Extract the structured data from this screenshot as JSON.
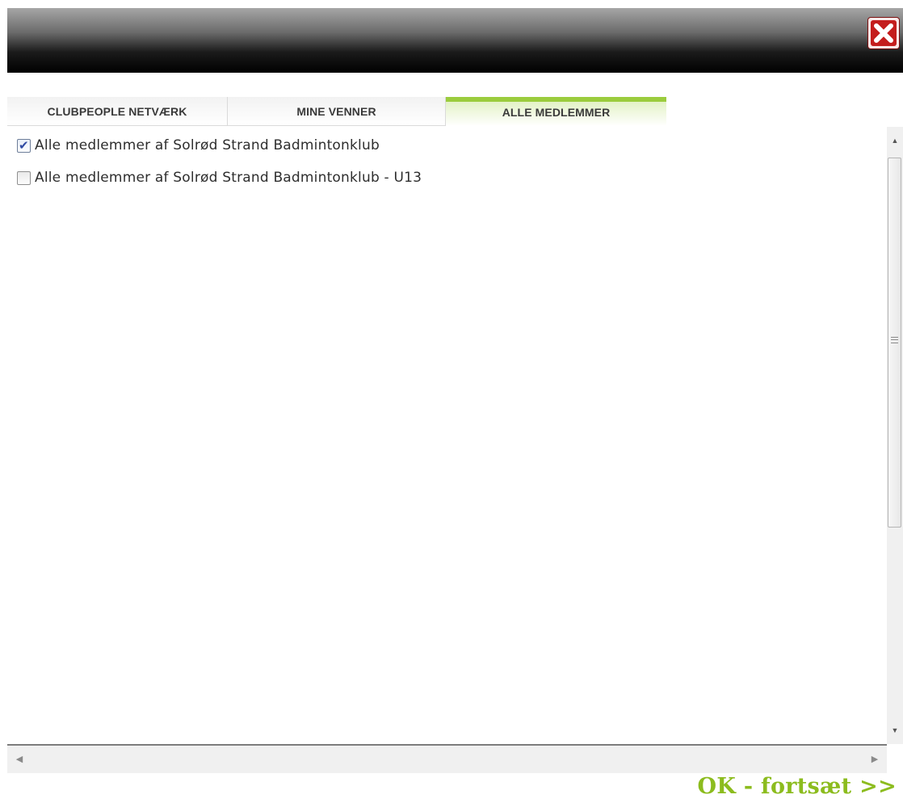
{
  "dialog": {
    "close_icon": "close-x-icon",
    "accent_color": "#9bcc3d"
  },
  "tabs": [
    {
      "label": "CLUBPEOPLE NETVÆRK",
      "active": false
    },
    {
      "label": "MINE VENNER",
      "active": false
    },
    {
      "label": "ALLE MEDLEMMER",
      "active": true
    }
  ],
  "list": {
    "items": [
      {
        "label": "Alle medlemmer af Solrød Strand Badmintonklub",
        "checked": true
      },
      {
        "label": "Alle medlemmer af Solrød Strand Badmintonklub - U13",
        "checked": false
      }
    ]
  },
  "footer": {
    "ok_label": "OK - fortsæt >>",
    "ok_color": "#8cbc1e"
  }
}
